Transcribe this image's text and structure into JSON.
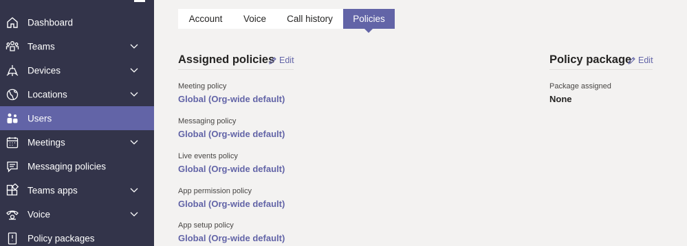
{
  "sidebar": {
    "items": [
      {
        "label": "Dashboard",
        "icon": "home-icon",
        "expandable": false
      },
      {
        "label": "Teams",
        "icon": "teams-icon",
        "expandable": true
      },
      {
        "label": "Devices",
        "icon": "devices-icon",
        "expandable": true
      },
      {
        "label": "Locations",
        "icon": "globe-icon",
        "expandable": true
      },
      {
        "label": "Users",
        "icon": "users-icon",
        "expandable": false,
        "active": true
      },
      {
        "label": "Meetings",
        "icon": "calendar-icon",
        "expandable": true
      },
      {
        "label": "Messaging policies",
        "icon": "message-icon",
        "expandable": false
      },
      {
        "label": "Teams apps",
        "icon": "apps-icon",
        "expandable": true
      },
      {
        "label": "Voice",
        "icon": "phone-icon",
        "expandable": true
      },
      {
        "label": "Policy packages",
        "icon": "package-icon",
        "expandable": false
      }
    ]
  },
  "tabs": [
    {
      "label": "Account"
    },
    {
      "label": "Voice"
    },
    {
      "label": "Call history"
    },
    {
      "label": "Policies",
      "active": true
    }
  ],
  "assigned": {
    "title": "Assigned policies",
    "edit_label": "Edit",
    "policies": [
      {
        "label": "Meeting policy",
        "value": "Global (Org-wide default)"
      },
      {
        "label": "Messaging policy",
        "value": "Global (Org-wide default)"
      },
      {
        "label": "Live events policy",
        "value": "Global (Org-wide default)"
      },
      {
        "label": "App permission policy",
        "value": "Global (Org-wide default)"
      },
      {
        "label": "App setup policy",
        "value": "Global (Org-wide default)"
      }
    ]
  },
  "package": {
    "title": "Policy package",
    "edit_label": "Edit",
    "label": "Package assigned",
    "value": "None"
  },
  "colors": {
    "sidebar_bg": "#33344a",
    "accent": "#6264a7",
    "page_bg": "#f3f2f1"
  }
}
